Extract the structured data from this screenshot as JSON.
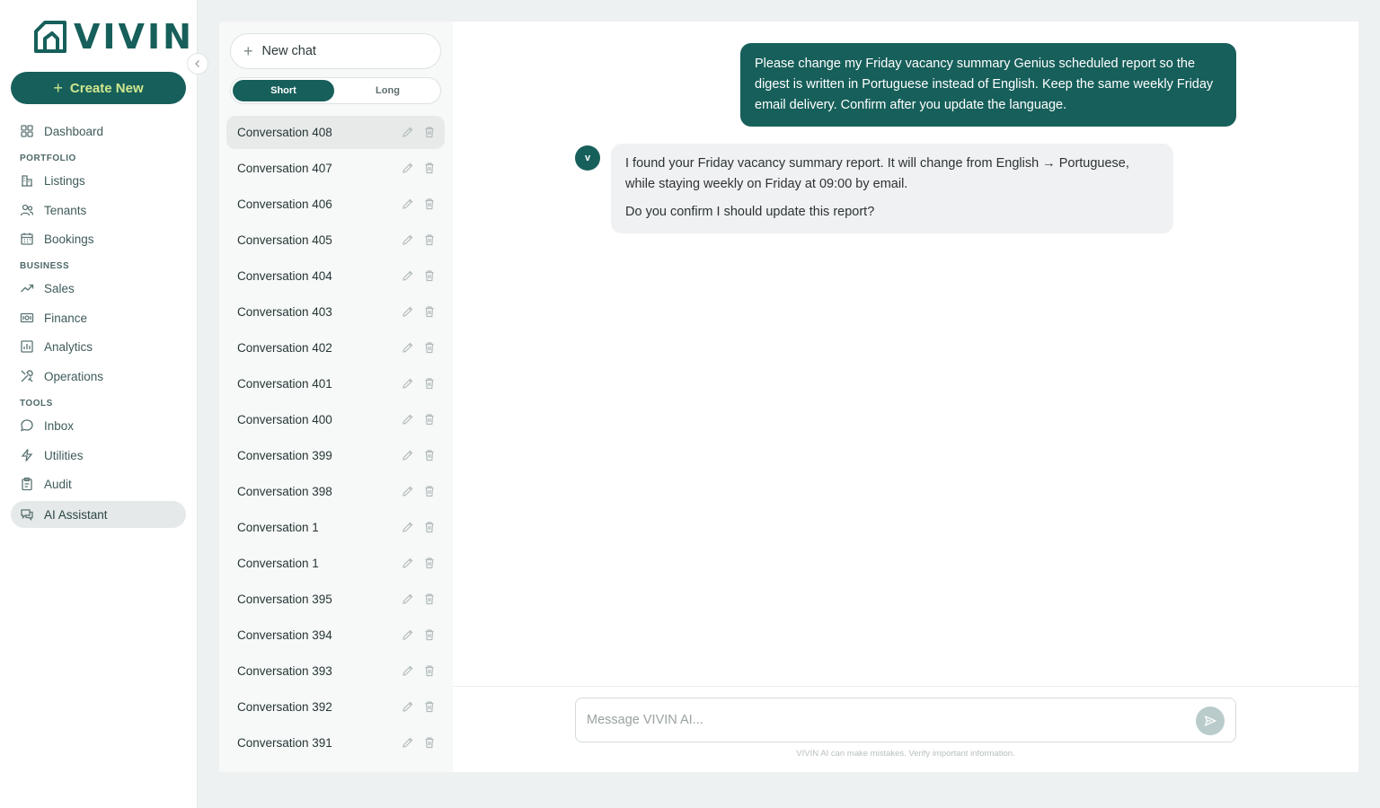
{
  "brand": {
    "name": "VIVIN",
    "accent": "#175f5a",
    "accent_text": "#cfe88f"
  },
  "sidebar": {
    "create_label": "Create New",
    "top_items": [
      {
        "label": "Dashboard",
        "icon": "grid-icon"
      }
    ],
    "sections": [
      {
        "title": "PORTFOLIO",
        "items": [
          {
            "label": "Listings",
            "icon": "building-icon"
          },
          {
            "label": "Tenants",
            "icon": "users-icon"
          },
          {
            "label": "Bookings",
            "icon": "calendar-icon"
          }
        ]
      },
      {
        "title": "BUSINESS",
        "items": [
          {
            "label": "Sales",
            "icon": "trending-up-icon"
          },
          {
            "label": "Finance",
            "icon": "banknote-icon"
          },
          {
            "label": "Analytics",
            "icon": "bar-chart-icon"
          },
          {
            "label": "Operations",
            "icon": "tools-icon"
          }
        ]
      },
      {
        "title": "TOOLS",
        "items": [
          {
            "label": "Inbox",
            "icon": "message-icon"
          },
          {
            "label": "Utilities",
            "icon": "bolt-icon"
          },
          {
            "label": "Audit",
            "icon": "clipboard-icon"
          },
          {
            "label": "AI Assistant",
            "icon": "chat-bubbles-icon",
            "active": true
          }
        ]
      }
    ]
  },
  "conversations": {
    "new_chat_label": "New chat",
    "toggle": {
      "short": "Short",
      "long": "Long",
      "selected": "Short"
    },
    "items": [
      "Conversation 408",
      "Conversation 407",
      "Conversation 406",
      "Conversation 405",
      "Conversation 404",
      "Conversation 403",
      "Conversation 402",
      "Conversation 401",
      "Conversation 400",
      "Conversation 399",
      "Conversation 398",
      "Conversation 1",
      "Conversation 1",
      "Conversation 395",
      "Conversation 394",
      "Conversation 393",
      "Conversation 392",
      "Conversation 391"
    ],
    "active_index": 0
  },
  "chat": {
    "user_message": "Please change my Friday vacancy summary Genius scheduled report so the digest is written in Portuguese instead of English. Keep the same weekly Friday email delivery. Confirm after you update the language.",
    "bot_avatar": "v",
    "bot_message_line1": "I found your Friday vacancy summary report. It will change from English → Portuguese, while staying weekly on Friday at 09:00 by email.",
    "bot_message_line2": "Do you confirm I should update this report?",
    "composer_placeholder": "Message VIVIN AI...",
    "disclaimer": "VIVIN AI can make mistakes. Verify important information."
  }
}
